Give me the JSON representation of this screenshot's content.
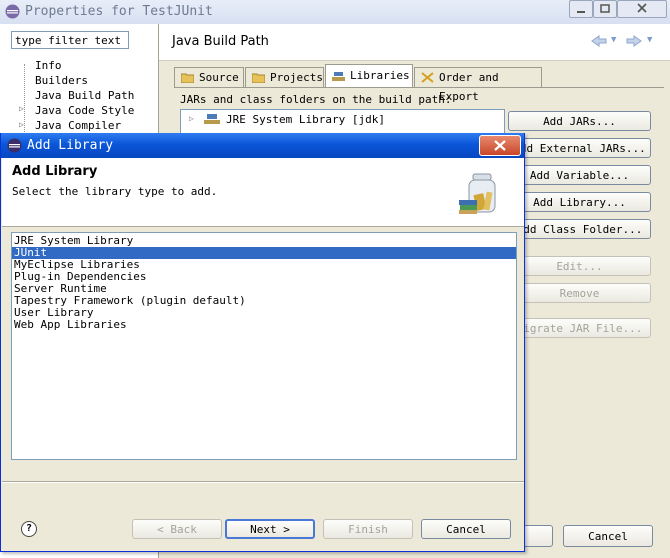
{
  "window": {
    "title": "Properties for TestJUnit"
  },
  "filter": {
    "placeholder": "type filter text"
  },
  "tree": [
    "Info",
    "Builders",
    "Java Build Path",
    "Java Code Style",
    "Java Compiler"
  ],
  "page_title": "Java Build Path",
  "tabs": [
    "Source",
    "Projects",
    "Libraries",
    "Order and Export"
  ],
  "build_path_label": "JARs and class folders on the build path:",
  "build_path_entry": "JRE System Library [jdk]",
  "side_buttons": [
    "Add JARs...",
    "Add External JARs...",
    "Add Variable...",
    "Add Library...",
    "Add Class Folder...",
    "Edit...",
    "Remove",
    "Migrate JAR File..."
  ],
  "parent_buttons": {
    "cancel": "Cancel"
  },
  "dialog": {
    "title": "Add Library",
    "heading": "Add Library",
    "description": "Select the library type to add.",
    "libraries": [
      "JRE System Library",
      "JUnit",
      "MyEclipse Libraries",
      "Plug-in Dependencies",
      "Server Runtime",
      "Tapestry Framework (plugin default)",
      "User Library",
      "Web App Libraries"
    ],
    "selected_library": "JUnit",
    "buttons": {
      "back": "< Back",
      "next": "Next >",
      "finish": "Finish",
      "cancel": "Cancel"
    },
    "help": "?"
  },
  "colors": {
    "selection": "#316ac5",
    "title_bar_active": "#0a56d9",
    "title_bar_inactive": "#dde6f6"
  }
}
